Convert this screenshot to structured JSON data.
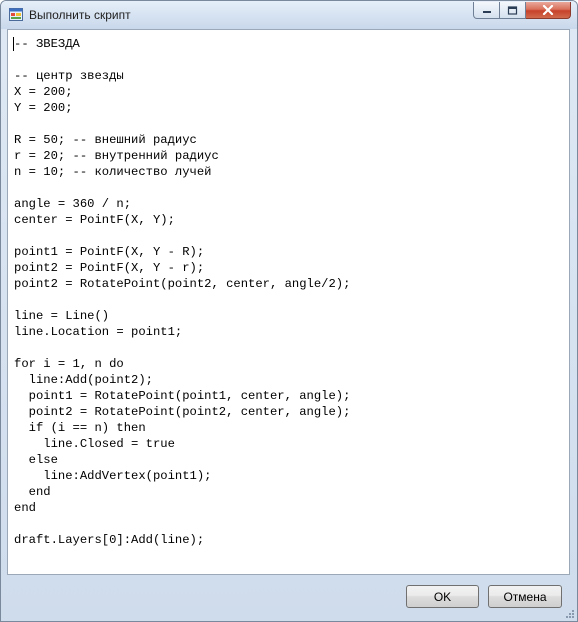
{
  "window": {
    "title": "Выполнить скрипт"
  },
  "editor": {
    "code_lines": [
      "-- ЗВЕЗДА",
      "",
      "-- центр звезды",
      "X = 200;",
      "Y = 200;",
      "",
      "R = 50; -- внешний радиус",
      "r = 20; -- внутренний радиус",
      "n = 10; -- количество лучей",
      "",
      "angle = 360 / n;",
      "center = PointF(X, Y);",
      "",
      "point1 = PointF(X, Y - R);",
      "point2 = PointF(X, Y - r);",
      "point2 = RotatePoint(point2, center, angle/2);",
      "",
      "line = Line()",
      "line.Location = point1;",
      "",
      "for i = 1, n do",
      "  line:Add(point2);",
      "  point1 = RotatePoint(point1, center, angle);",
      "  point2 = RotatePoint(point2, center, angle);",
      "  if (i == n) then",
      "    line.Closed = true",
      "  else",
      "    line:AddVertex(point1);",
      "  end",
      "end",
      "",
      "draft.Layers[0]:Add(line);"
    ]
  },
  "buttons": {
    "ok": "OK",
    "cancel": "Отмена"
  },
  "icons": {
    "app": "window-app-icon",
    "minimize": "minimize-icon",
    "maximize": "maximize-icon",
    "close": "close-icon",
    "grip": "resize-grip-icon"
  }
}
